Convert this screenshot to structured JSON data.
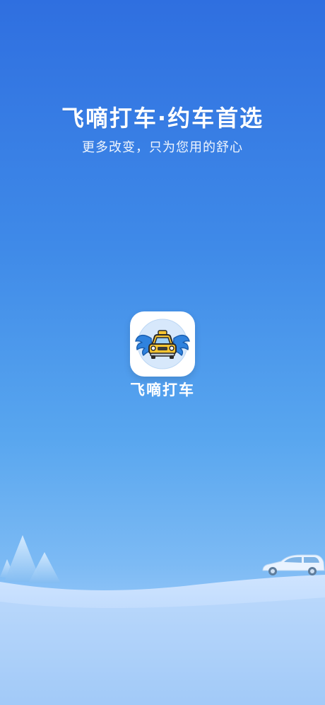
{
  "splash": {
    "headline": "飞嘀打车·约车首选",
    "subline": "更多改变，只为您用的舒心"
  },
  "app": {
    "name": "飞嘀打车",
    "logo_icon": "winged-taxi-icon"
  },
  "illustration": {
    "left": "mountain-icon",
    "right": "car-icon"
  },
  "colors": {
    "background_top": "#2f6fe0",
    "background_bottom": "#bedbff",
    "taxi_yellow": "#f7c531",
    "wing_blue": "#2f82de"
  }
}
